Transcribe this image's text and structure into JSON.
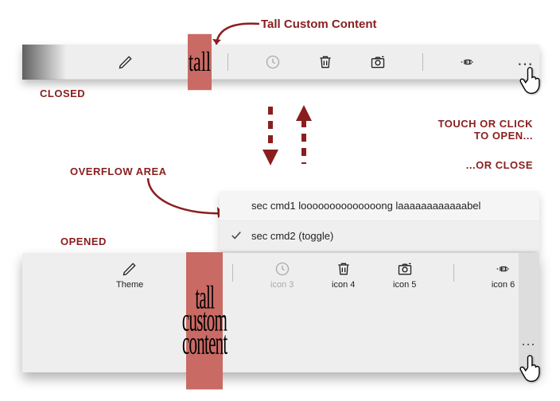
{
  "annotations": {
    "tall_custom_content": "Tall Custom Content",
    "closed": "CLOSED",
    "touch_open": "TOUCH OR CLICK\nTO OPEN...",
    "or_close": "...OR CLOSE",
    "overflow_area": "OVERFLOW AREA",
    "opened": "OPENED"
  },
  "tall_badge": {
    "short": "tall",
    "line1": "tall",
    "line2": "custom",
    "line3": "content"
  },
  "overflow": {
    "item1": "sec cmd1 loooooooooooooong laaaaaaaaaaaabel",
    "item2": "sec cmd2 (toggle)"
  },
  "open_items": {
    "theme": "Theme",
    "icon3": "icon 3",
    "icon4": "icon 4",
    "icon5": "icon 5",
    "icon6": "icon 6"
  },
  "ellipsis": "⋯"
}
